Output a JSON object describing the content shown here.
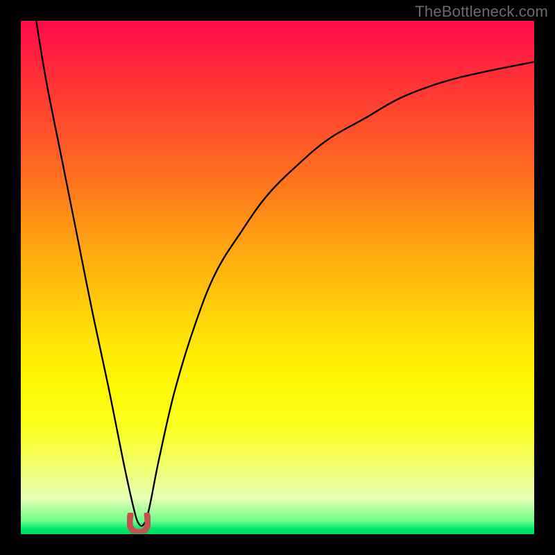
{
  "watermark": {
    "text": "TheBottleneck.com"
  },
  "colors": {
    "curve_stroke": "#000000",
    "marker_fill": "#c1524c",
    "frame_bg": "#000000"
  },
  "chart_data": {
    "type": "line",
    "title": "",
    "xlabel": "",
    "ylabel": "",
    "xlim": [
      0,
      100
    ],
    "ylim": [
      0,
      100
    ],
    "grid": false,
    "legend": false,
    "series": [
      {
        "name": "curve",
        "x": [
          3,
          5,
          8,
          11,
          14,
          17,
          20,
          22,
          23,
          24,
          25,
          27,
          30,
          34,
          38,
          43,
          48,
          54,
          60,
          67,
          74,
          82,
          90,
          100
        ],
        "y": [
          100,
          88,
          73,
          58,
          43,
          29,
          14,
          5,
          2,
          2,
          5,
          15,
          28,
          41,
          51,
          59,
          66,
          72,
          77,
          81,
          85,
          88,
          90,
          92
        ]
      }
    ],
    "marker": {
      "x": 23,
      "y": 2,
      "shape": "u",
      "color": "#c1524c"
    },
    "background_gradient": {
      "top": "#ff0a4a",
      "mid": "#fff700",
      "bottom": "#00d85e"
    }
  }
}
